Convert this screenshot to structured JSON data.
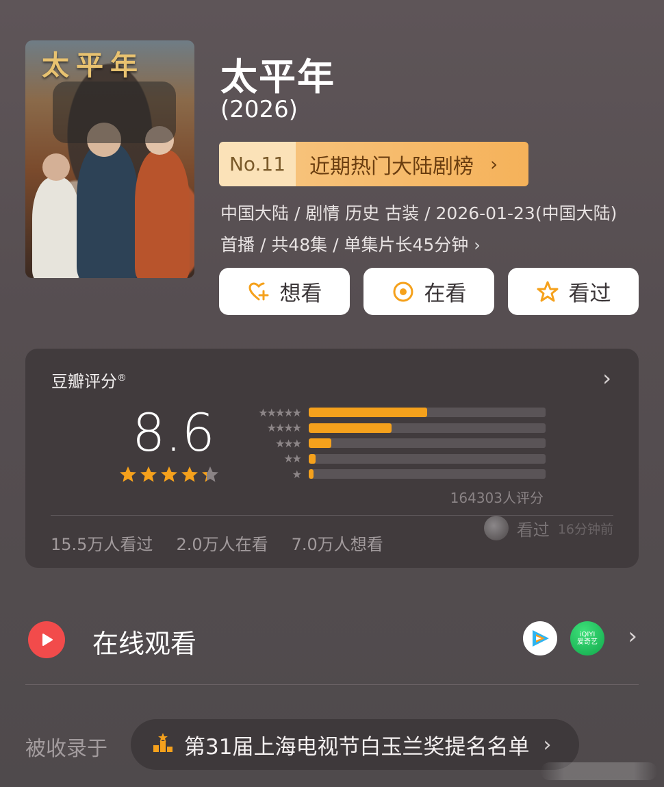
{
  "poster": {
    "title_art": "太平年"
  },
  "title": "太平年",
  "year": "(2026)",
  "rank": {
    "number": "No.11",
    "label": "近期热门大陆剧榜",
    "chevron": "›"
  },
  "meta": {
    "line1": "中国大陆 / 剧情 历史 古装 / 2026-01-23(中国大陆)",
    "line2": "首播 / 共48集 / 单集片长45分钟",
    "chevron": "›"
  },
  "actions": {
    "want": {
      "label": "想看",
      "icon": "heart-plus-icon"
    },
    "watching": {
      "label": "在看",
      "icon": "target-icon"
    },
    "watched": {
      "label": "看过",
      "icon": "star-outline-icon"
    }
  },
  "rating": {
    "heading": "豆瓣评分",
    "mark": "®",
    "chevron": "›",
    "score": "8.6",
    "stars_value": 4.3,
    "distribution": [
      {
        "stars": "★★★★★",
        "fraction": 0.5
      },
      {
        "stars": "★★★★",
        "fraction": 0.35
      },
      {
        "stars": "★★★",
        "fraction": 0.095
      },
      {
        "stars": "★★",
        "fraction": 0.03
      },
      {
        "stars": "★",
        "fraction": 0.02
      }
    ],
    "count_text": "164303人评分",
    "stats": {
      "watched": "15.5万人看过",
      "watching": "2.0万人在看",
      "want": "7.0万人想看"
    },
    "recent": {
      "action": "看过",
      "time": "16分钟前"
    }
  },
  "online": {
    "label": "在线观看",
    "platforms": [
      {
        "name": "tencent-video",
        "icon": "tencent-video-icon"
      },
      {
        "name": "iqiyi",
        "line1": "iQIYI",
        "line2": "爱奇艺"
      }
    ],
    "chevron": "›"
  },
  "collected": {
    "label": "被收录于",
    "item": "第31届上海电视节白玉兰奖提名名单",
    "chevron": "›"
  },
  "colors": {
    "accent": "#f5a11c",
    "play_red": "#f24b4b",
    "iqiyi_green": "#11a84b"
  }
}
